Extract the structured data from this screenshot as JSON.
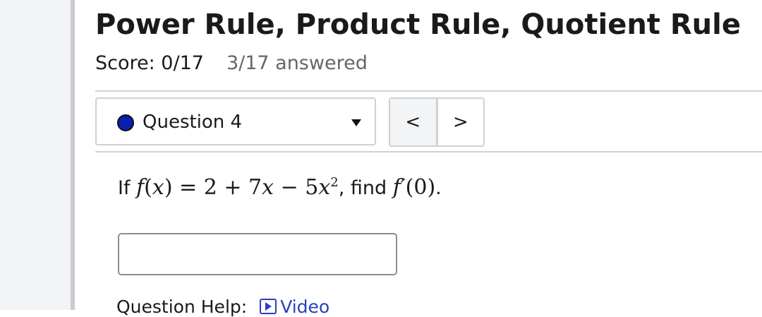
{
  "page": {
    "title": "Power Rule, Product Rule, Quotient Rule",
    "score": "Score: 0/17",
    "answered": "3/17 answered"
  },
  "question_selector": {
    "label": "Question 4",
    "status_color": "#0a1fae"
  },
  "nav": {
    "prev_label": "<",
    "next_label": ">"
  },
  "question": {
    "prefix": "If ",
    "function_name": "f",
    "variable": "x",
    "rhs_a": "2 + 7",
    "rhs_b": " − 5",
    "exponent": "2",
    "middle": ", find ",
    "derivative": "f′",
    "eval_point": "(0)",
    "end": "."
  },
  "answer": {
    "value": "",
    "placeholder": ""
  },
  "help": {
    "label": "Question Help:",
    "video_label": "Video",
    "video_icon": "play-icon"
  }
}
